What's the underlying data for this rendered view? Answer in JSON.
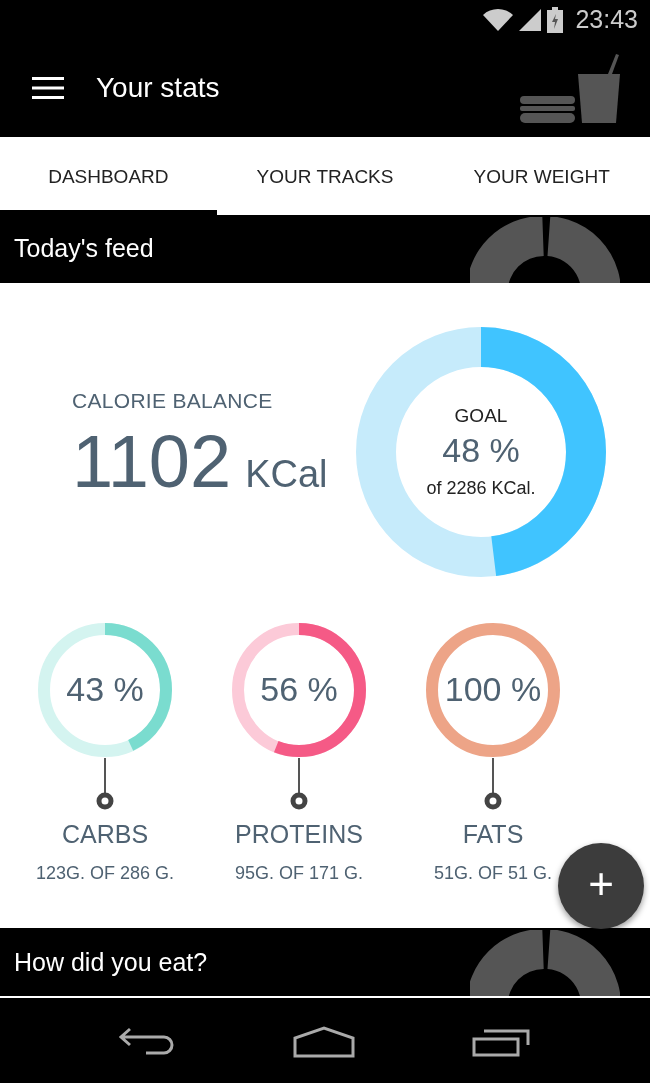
{
  "status_bar": {
    "time": "23:43"
  },
  "app_bar": {
    "title": "Your stats"
  },
  "tabs": [
    {
      "label": "DASHBOARD",
      "selected": true
    },
    {
      "label": "YOUR TRACKS",
      "selected": false
    },
    {
      "label": "YOUR WEIGHT",
      "selected": false
    }
  ],
  "feed_header": {
    "title": "Today's feed"
  },
  "calories": {
    "label": "CALORIE BALANCE",
    "value": "1102",
    "unit": "KCal",
    "goal_label": "GOAL",
    "percent": "48 %",
    "goal_text": "of 2286 KCal.",
    "level": 0.48
  },
  "macros": [
    {
      "name": "CARBS",
      "percent": "43 %",
      "amount": "123G. OF 286 G.",
      "level": 0.43,
      "color": "#7adccf"
    },
    {
      "name": "PROTEINS",
      "percent": "56 %",
      "amount": "95G. OF 171 G.",
      "level": 0.56,
      "color": "#f55a86"
    },
    {
      "name": "FATS",
      "percent": "100 %",
      "amount": "51G. OF 51 G.",
      "level": 1,
      "color": "#eda487"
    }
  ],
  "fab": {
    "label": "+"
  },
  "eat_header": {
    "title": "How did you eat?"
  }
}
